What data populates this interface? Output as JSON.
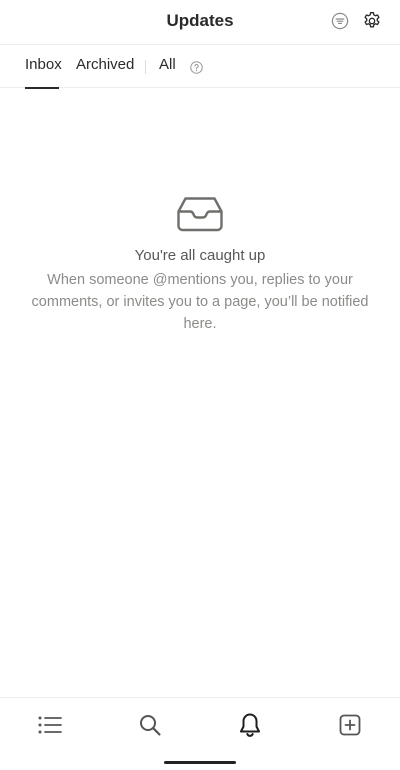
{
  "header": {
    "title": "Updates",
    "filter_icon": "filter-lines-icon",
    "settings_icon": "gear-icon"
  },
  "tabs": {
    "items": [
      {
        "label": "Inbox",
        "active": true
      },
      {
        "label": "Archived",
        "active": false
      },
      {
        "label": "All",
        "active": false
      }
    ],
    "help_icon": "question-circle-icon"
  },
  "empty_state": {
    "icon": "inbox-tray-icon",
    "title": "You're all caught up",
    "description": "When someone @mentions you, replies to your comments, or invites you to a page, you’ll be notified here."
  },
  "bottom_nav": {
    "items": [
      {
        "icon": "list-icon",
        "active": false
      },
      {
        "icon": "search-icon",
        "active": false
      },
      {
        "icon": "bell-icon",
        "active": true
      },
      {
        "icon": "plus-square-icon",
        "active": false
      }
    ]
  },
  "colors": {
    "text_primary": "#2b2b2b",
    "text_secondary": "#8c8b87",
    "divider": "#ececeb"
  }
}
